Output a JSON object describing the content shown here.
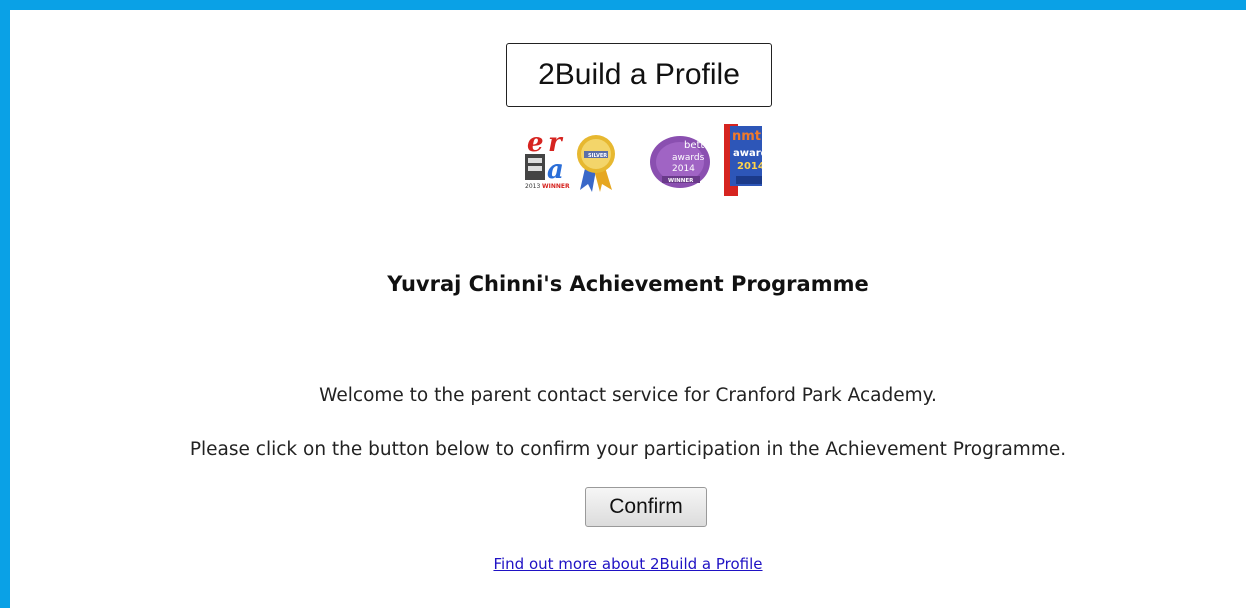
{
  "header": {
    "brand": "2Build a Profile",
    "awards": [
      {
        "name": "era-award-logo",
        "text_top": "era",
        "text_bottom": "2013 WINNER"
      },
      {
        "name": "silver-award-badge",
        "text": "SILVER"
      },
      {
        "name": "bett-award-logo",
        "text_top": "bett",
        "text_mid": "awards",
        "text_year": "2014",
        "text_bottom": "WINNER"
      },
      {
        "name": "nmt-award-logo",
        "text_top": "nmt",
        "text_mid": "awards",
        "text_year": "2014"
      }
    ]
  },
  "main": {
    "title": "Yuvraj Chinni's Achievement Programme",
    "welcome": "Welcome to the parent contact service for Cranford Park Academy.",
    "instruction": "Please click on the button below to confirm your participation in the Achievement Programme.",
    "confirm_label": "Confirm",
    "more_link": "Find out more about 2Build a Profile"
  },
  "colors": {
    "frame": "#0aa1e6",
    "link": "#1f12c4"
  }
}
